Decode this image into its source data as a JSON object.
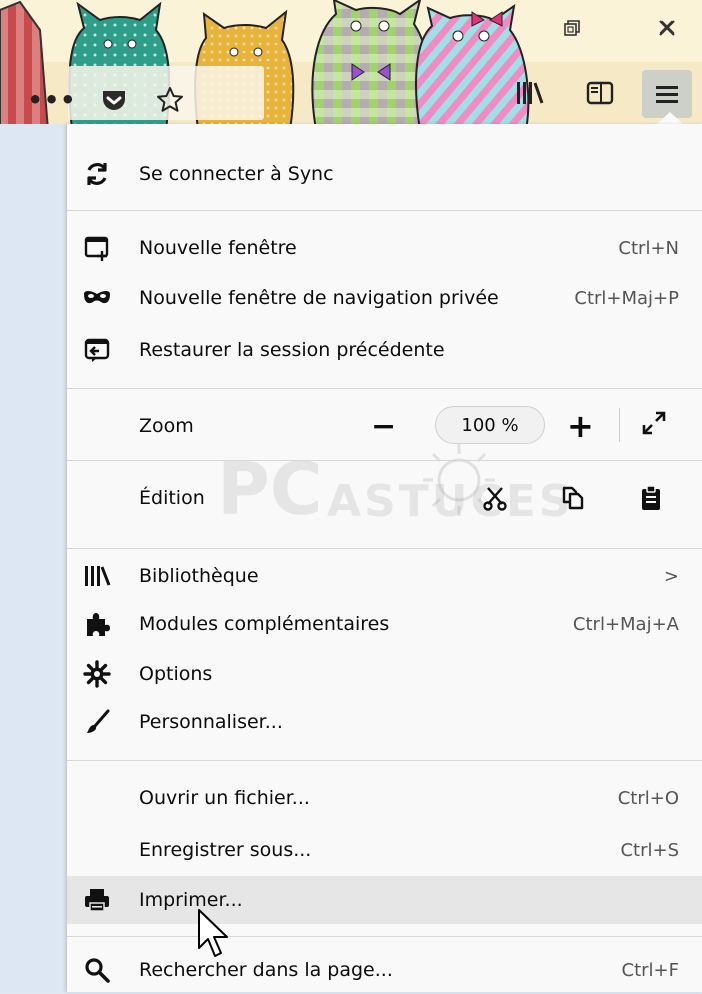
{
  "window": {
    "restore_icon": "restore-icon",
    "close_icon": "close-icon"
  },
  "toolbar": {
    "more_label": "•••",
    "pocket_icon": "pocket-icon",
    "bookmark_icon": "star-icon",
    "library_icon": "library-icon",
    "sidebar_icon": "sidebar-icon",
    "menu_icon": "hamburger-icon"
  },
  "menu": {
    "sync": {
      "label": "Se connecter à Sync"
    },
    "new_window": {
      "label": "Nouvelle fenêtre",
      "shortcut": "Ctrl+N"
    },
    "private_window": {
      "label": "Nouvelle fenêtre de navigation privée",
      "shortcut": "Ctrl+Maj+P"
    },
    "restore_session": {
      "label": "Restaurer la session précédente"
    },
    "zoom": {
      "label": "Zoom",
      "minus": "−",
      "value": "100 %",
      "plus": "+"
    },
    "edit": {
      "label": "Édition"
    },
    "library": {
      "label": "Bibliothèque",
      "chevron": ">"
    },
    "addons": {
      "label": "Modules complémentaires",
      "shortcut": "Ctrl+Maj+A"
    },
    "options": {
      "label": "Options"
    },
    "customize": {
      "label": "Personnaliser..."
    },
    "open_file": {
      "label": "Ouvrir un fichier...",
      "shortcut": "Ctrl+O"
    },
    "save_as": {
      "label": "Enregistrer sous...",
      "shortcut": "Ctrl+S"
    },
    "print": {
      "label": "Imprimer..."
    },
    "find": {
      "label": "Rechercher dans la page...",
      "shortcut": "Ctrl+F"
    }
  },
  "colors": {
    "menu_bg": "#f9f9fa",
    "hover_bg": "#e6e6e6",
    "separator": "#d7d7db",
    "theme_bg": "#fbf3d7"
  }
}
